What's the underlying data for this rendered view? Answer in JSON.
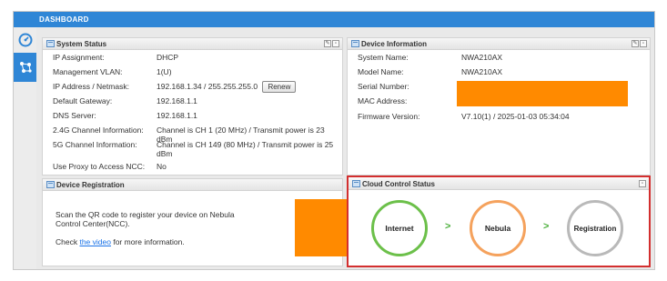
{
  "header": {
    "title": "DASHBOARD"
  },
  "sidebar": {
    "items": [
      {
        "icon": "dashboard-gauge-icon"
      },
      {
        "icon": "nebula-network-icon"
      }
    ]
  },
  "system_status": {
    "title": "System Status",
    "rows": [
      {
        "label": "IP Assignment:",
        "value": "DHCP"
      },
      {
        "label": "Management VLAN:",
        "value": "1(U)"
      },
      {
        "label": "IP Address / Netmask:",
        "value": "192.168.1.34 / 255.255.255.0"
      },
      {
        "label": "Default Gateway:",
        "value": "192.168.1.1"
      },
      {
        "label": "DNS Server:",
        "value": "192.168.1.1"
      },
      {
        "label": "2.4G Channel Information:",
        "value": "Channel is CH 1 (20 MHz) / Transmit power is 23 dBm"
      },
      {
        "label": "5G Channel Information:",
        "value_line1": "Channel is CH 149 (80 MHz) / Transmit power is 25",
        "value_line2": "dBm"
      },
      {
        "label": "Use Proxy to Access NCC:",
        "value": "No"
      }
    ],
    "renew_label": "Renew"
  },
  "device_info": {
    "title": "Device Information",
    "rows": [
      {
        "label": "System Name:",
        "value": "NWA210AX"
      },
      {
        "label": "Model Name:",
        "value": "NWA210AX"
      },
      {
        "label": "Serial Number:",
        "value": ""
      },
      {
        "label": "MAC Address:",
        "value": ""
      },
      {
        "label": "Firmware Version:",
        "value": "V7.10(1) / 2025-01-03 05:34:04"
      }
    ]
  },
  "device_registration": {
    "title": "Device Registration",
    "line1": "Scan the QR code to register your device on Nebula",
    "line2": "Control Center(NCC).",
    "check_prefix": "Check ",
    "link_text": "the video",
    "check_suffix": " for more information."
  },
  "cloud_status": {
    "title": "Cloud Control Status",
    "steps": [
      {
        "label": "Internet",
        "color": "#6cc04a"
      },
      {
        "label": "Nebula",
        "color": "#f5a25d"
      },
      {
        "label": "Registration",
        "color": "#b9b9b9"
      }
    ],
    "arrow": ">",
    "highlight_color": "#d32f2f"
  },
  "colors": {
    "accent": "#2f86d6",
    "redacted": "#ff8a00"
  }
}
